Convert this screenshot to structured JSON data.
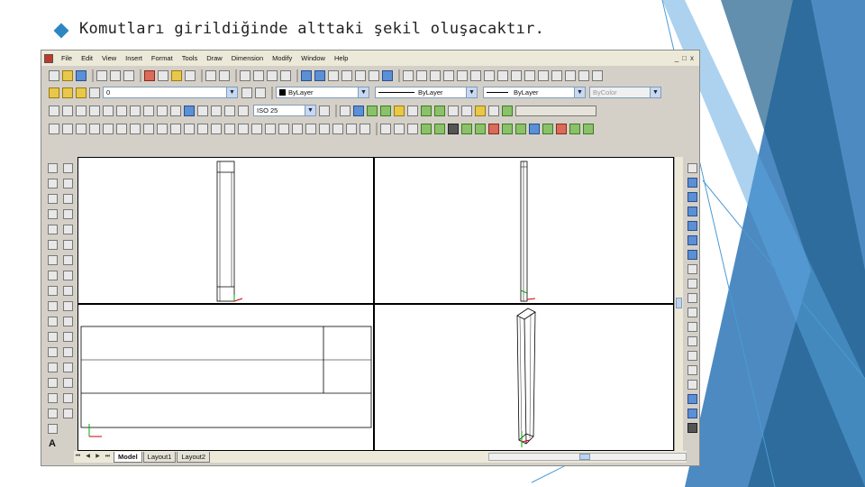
{
  "slide": {
    "heading": "Komutları girildiğinde alttaki şekil oluşacaktır.",
    "bullet_icon": "diamond-bullet-icon",
    "accent_colors": [
      "#2e86c1",
      "#1f5f8b",
      "#3b9ad9"
    ]
  },
  "app": {
    "menu": [
      "File",
      "Edit",
      "View",
      "Insert",
      "Format",
      "Tools",
      "Draw",
      "Dimension",
      "Modify",
      "Window",
      "Help"
    ],
    "window_buttons": [
      "_",
      "□",
      "x"
    ],
    "layer_combo": "0",
    "color_combo": "ByLayer",
    "linetype_combo": "ByLayer",
    "lineweight_combo": "ByLayer",
    "plotstyle_combo": "ByColor",
    "dimstyle_combo": "ISO 25",
    "text_tool_label": "A",
    "tabs": [
      "Model",
      "Layout1",
      "Layout2"
    ],
    "active_tab": "Model",
    "nav_buttons": [
      "⏮",
      "◀",
      "▶",
      "⏭"
    ]
  }
}
